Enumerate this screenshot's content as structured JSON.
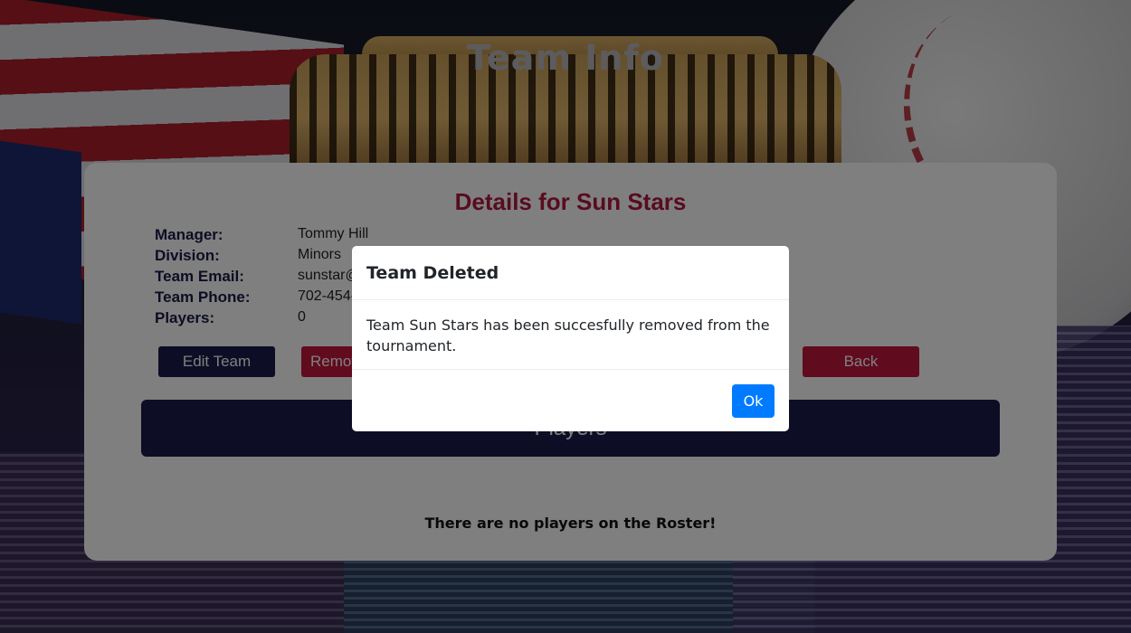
{
  "page": {
    "title": "Team Info"
  },
  "team": {
    "heading": "Details for Sun Stars",
    "details": [
      {
        "label": "Manager:",
        "value": "Tommy Hill"
      },
      {
        "label": "Division:",
        "value": "Minors"
      },
      {
        "label": "Team Email:",
        "value": "sunstar@"
      },
      {
        "label": "Team Phone:",
        "value": "702-454-"
      },
      {
        "label": "Players:",
        "value": "0"
      }
    ],
    "buttons": {
      "edit": "Edit Team",
      "remove": "Remov",
      "back": "Back"
    },
    "players_header": "Players",
    "empty_roster": "There are no players on the Roster!"
  },
  "modal": {
    "title": "Team Deleted",
    "message": "Team Sun Stars has been succesfully removed from the tournament.",
    "ok_label": "Ok"
  },
  "colors": {
    "accent_red": "#c2173f",
    "navy": "#1b1a4b",
    "modal_button": "#007bff"
  }
}
